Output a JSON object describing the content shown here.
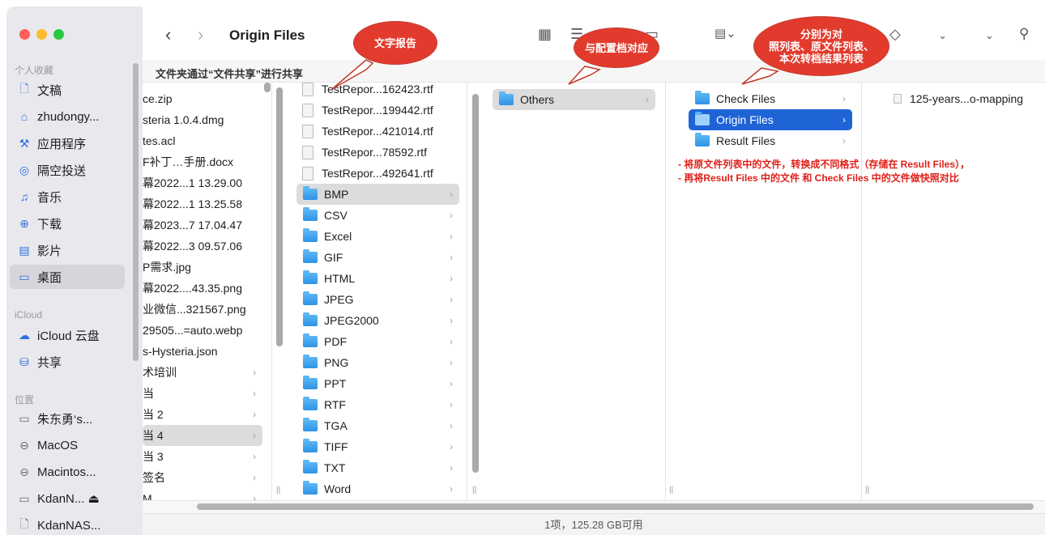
{
  "window": {
    "title": "Origin Files"
  },
  "pathbar": {
    "text": "文件夹通过“文件共享”进行共享"
  },
  "sidebar": {
    "sections": {
      "favorites": "个人收藏",
      "icloud": "iCloud",
      "locations": "位置"
    },
    "favorites": [
      {
        "label": "文稿",
        "icon": "document-icon"
      },
      {
        "label": "zhudongy...",
        "icon": "home-icon"
      },
      {
        "label": "应用程序",
        "icon": "applications-icon"
      },
      {
        "label": "隔空投送",
        "icon": "airdrop-icon"
      },
      {
        "label": "音乐",
        "icon": "music-icon"
      },
      {
        "label": "下载",
        "icon": "download-icon"
      },
      {
        "label": "影片",
        "icon": "film-icon"
      },
      {
        "label": "桌面",
        "icon": "desktop-icon"
      }
    ],
    "icloud": [
      {
        "label": "iCloud 云盘",
        "icon": "cloud-icon"
      },
      {
        "label": "共享",
        "icon": "shared-folder-icon"
      }
    ],
    "locations": [
      {
        "label": "朱东勇‘s...",
        "icon": "laptop-icon"
      },
      {
        "label": "MacOS",
        "icon": "disk-icon"
      },
      {
        "label": "Macintos...",
        "icon": "disk-icon"
      },
      {
        "label": "KdanN... ⏏",
        "icon": "display-icon"
      },
      {
        "label": "KdanNAS...",
        "icon": "document-icon"
      }
    ]
  },
  "columns": {
    "col1": [
      "ce.zip",
      "steria 1.0.4.dmg",
      "tes.acl",
      "F补丁…手册.docx",
      "幕2022...1 13.29.00",
      "幕2022...1 13.25.58",
      "幕2023...7 17.04.47",
      "幕2022...3 09.57.06",
      "P需求.jpg",
      "幕2022....43.35.png",
      "业微信...321567.png",
      "29505...=auto.webp",
      "s-Hysteria.json",
      "术培训",
      "当",
      "当 2",
      "当 4",
      "当 3",
      "签名",
      "M"
    ],
    "col2_files": [
      "TestRepor...162423.rtf",
      "TestRepor...199442.rtf",
      "TestRepor...421014.rtf",
      "TestRepor...78592.rtf",
      "TestRepor...492641.rtf"
    ],
    "col2_folders": [
      "BMP",
      "CSV",
      "Excel",
      "GIF",
      "HTML",
      "JPEG",
      "JPEG2000",
      "PDF",
      "PNG",
      "PPT",
      "RTF",
      "TGA",
      "TIFF",
      "TXT",
      "Word"
    ],
    "col3": [
      "Others"
    ],
    "col4": [
      "Check Files",
      "Origin Files",
      "Result Files"
    ],
    "col5": [
      "125-years...o-mapping"
    ]
  },
  "annotations": {
    "bubble1": "文字报告",
    "bubble2": "与配置档对应",
    "bubble3_line1": "分别为对",
    "bubble3_line2": "照列表、原文件列表、",
    "bubble3_line3": "本次转档结果列表",
    "note1": "- 将原文件列表中的文件，转换成不同格式（存储在 Result Files），",
    "note2": "- 再将Result Files 中的文件 和 Check Files 中的文件做快照对比"
  },
  "status": {
    "text": "1项，125.28 GB可用"
  },
  "colors": {
    "selection_blue": "#1e64d7",
    "annotation_red": "#e23b2e",
    "folder_blue": "#2e93e6"
  }
}
